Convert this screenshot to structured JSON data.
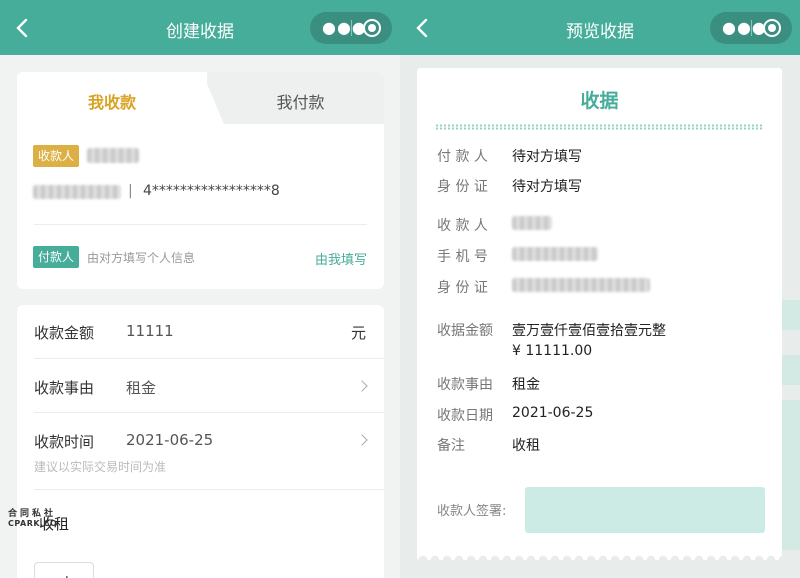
{
  "left": {
    "nav_title": "创建收据",
    "tabs": {
      "active": "我收款",
      "inactive": "我付款"
    },
    "payee_badge": "收款人",
    "id_partial": "4*****************8",
    "separator": "|",
    "payer_badge": "付款人",
    "payer_hint": "由对方填写个人信息",
    "self_fill_link": "由我填写",
    "rows": {
      "amount_label": "收款金额",
      "amount_value": "11111",
      "amount_unit": "元",
      "reason_label": "收款事由",
      "reason_value": "租金",
      "time_label": "收款时间",
      "time_value": "2021-06-25",
      "time_hint": "建议以实际交易时间为准"
    },
    "note_label": "收租",
    "watermark_top": "合同私社",
    "watermark_bottom": "CPARK.CO"
  },
  "right": {
    "nav_title": "预览收据",
    "receipt_title": "收据",
    "payer_label": "付 款 人",
    "payer_value": "待对方填写",
    "payer_id_label": "身 份 证",
    "payer_id_value": "待对方填写",
    "payee_label": "收 款 人",
    "phone_label": "手 机 号",
    "payee_id_label": "身 份 证",
    "amount_label": "收据金额",
    "amount_upper": "壹万壹仟壹佰壹拾壹元整",
    "amount_number": "¥ 11111.00",
    "reason_label": "收款事由",
    "reason_value": "租金",
    "date_label": "收款日期",
    "date_value": "2021-06-25",
    "remark_label": "备注",
    "remark_value": "收租",
    "signature_label": "收款人签署:"
  },
  "colors": {
    "primary": "#46ad9b",
    "gold": "#ddb046",
    "dark_capsule": "#3a8f80"
  },
  "icons": [
    "back-icon",
    "more-icon",
    "target-icon",
    "chevron-right-icon"
  ]
}
